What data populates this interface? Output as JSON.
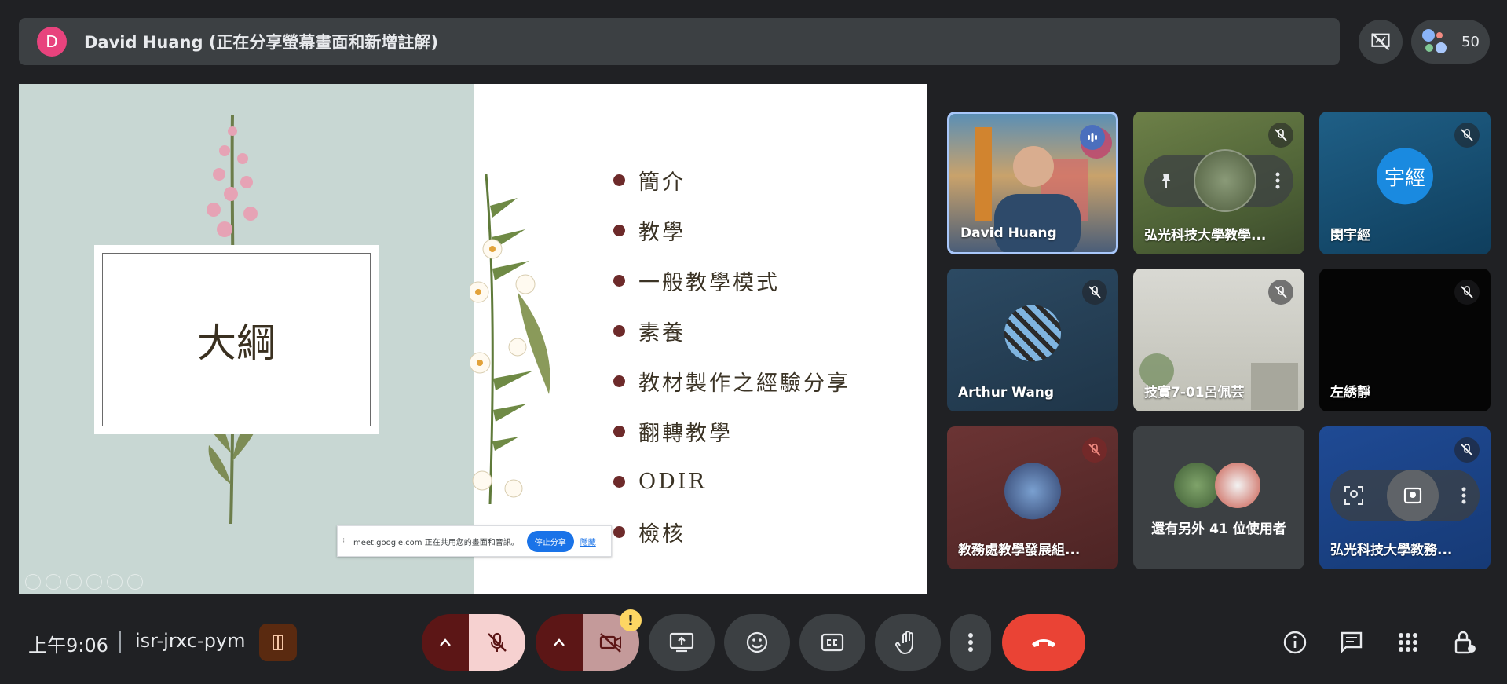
{
  "presenter_bar": {
    "avatar_letter": "D",
    "title": "David Huang (正在分享螢幕畫面和新增註解)"
  },
  "people": {
    "count": "50"
  },
  "slide": {
    "title": "大綱",
    "agenda": [
      "簡介",
      "教學",
      "一般教學模式",
      "素養",
      "教材製作之經驗分享",
      "翻轉教學",
      "ODIR",
      "檢核"
    ],
    "share_notice": {
      "text": "meet.google.com 正在共用您的畫面和音訊。",
      "stop_label": "停止分享",
      "hide_label": "隱藏"
    }
  },
  "participants": [
    {
      "name": "David Huang",
      "state": "speaking"
    },
    {
      "name": "弘光科技大學教學...",
      "state": "muted"
    },
    {
      "name": "閔宇經",
      "avatar_text": "宇經",
      "state": "muted"
    },
    {
      "name": "Arthur Wang",
      "state": "muted"
    },
    {
      "name": "技實7-01呂佩芸",
      "state": "muted"
    },
    {
      "name": "左綉靜",
      "state": "muted"
    },
    {
      "name": "教務處教學發展組...",
      "state": "muted"
    },
    {
      "name": "還有另外 41 位使用者",
      "state": "overflow"
    },
    {
      "name": "弘光科技大學教務...",
      "state": "muted"
    }
  ],
  "bottom": {
    "time": "上午9:06",
    "meeting_code": "isr-jrxc-pym",
    "camera_warning": "!"
  },
  "colors": {
    "background": "#202124",
    "surface": "#3c4043",
    "end_call": "#ea4335",
    "mic_off_bg": "#f6d1d0",
    "muted_group": "#5c1616",
    "avatar_blue": "#1a73e8",
    "presenter_avatar": "#e8437d"
  }
}
